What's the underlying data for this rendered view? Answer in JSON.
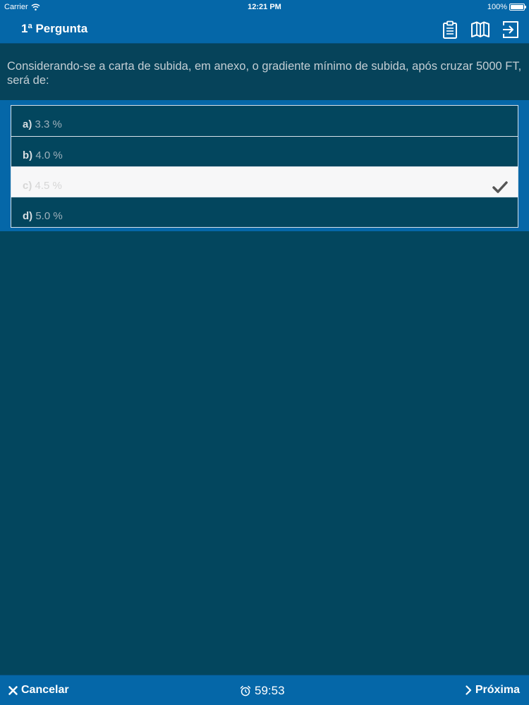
{
  "status_bar": {
    "carrier": "Carrier",
    "time": "12:21 PM",
    "battery": "100%"
  },
  "nav": {
    "title": "1ª Pergunta",
    "icons": [
      "clipboard-icon",
      "map-icon",
      "exit-icon"
    ]
  },
  "question": {
    "text": "Considerando-se a carta de subida, em anexo, o gradiente mínimo de subida, após cruzar 5000 FT, será de:"
  },
  "answers": [
    {
      "letter": "a)",
      "text": "3.3 %",
      "selected": false
    },
    {
      "letter": "b)",
      "text": "4.0 %",
      "selected": false
    },
    {
      "letter": "c)",
      "text": "4.5 %",
      "selected": true
    },
    {
      "letter": "d)",
      "text": "5.0 %",
      "selected": false
    }
  ],
  "bottom": {
    "cancel_label": "Cancelar",
    "timer": "59:53",
    "next_label": "Próxima"
  },
  "colors": {
    "bar_blue": "#0567a8",
    "background": "#03465e",
    "question_bg": "#06435a",
    "selected_row": "#f7f7f8"
  }
}
